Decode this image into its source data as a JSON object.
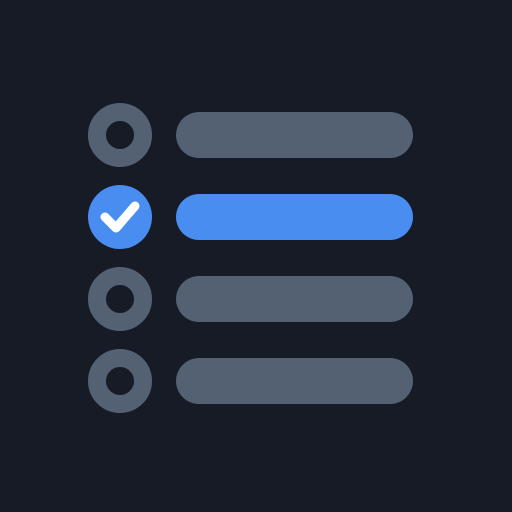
{
  "colors": {
    "background": "#161b26",
    "inactive": "#536173",
    "active": "#4a8df0",
    "check": "#ffffff"
  },
  "checklist": {
    "items": [
      {
        "checked": false,
        "icon": "radio-empty-icon"
      },
      {
        "checked": true,
        "icon": "check-icon"
      },
      {
        "checked": false,
        "icon": "radio-empty-icon"
      },
      {
        "checked": false,
        "icon": "radio-empty-icon"
      }
    ]
  }
}
